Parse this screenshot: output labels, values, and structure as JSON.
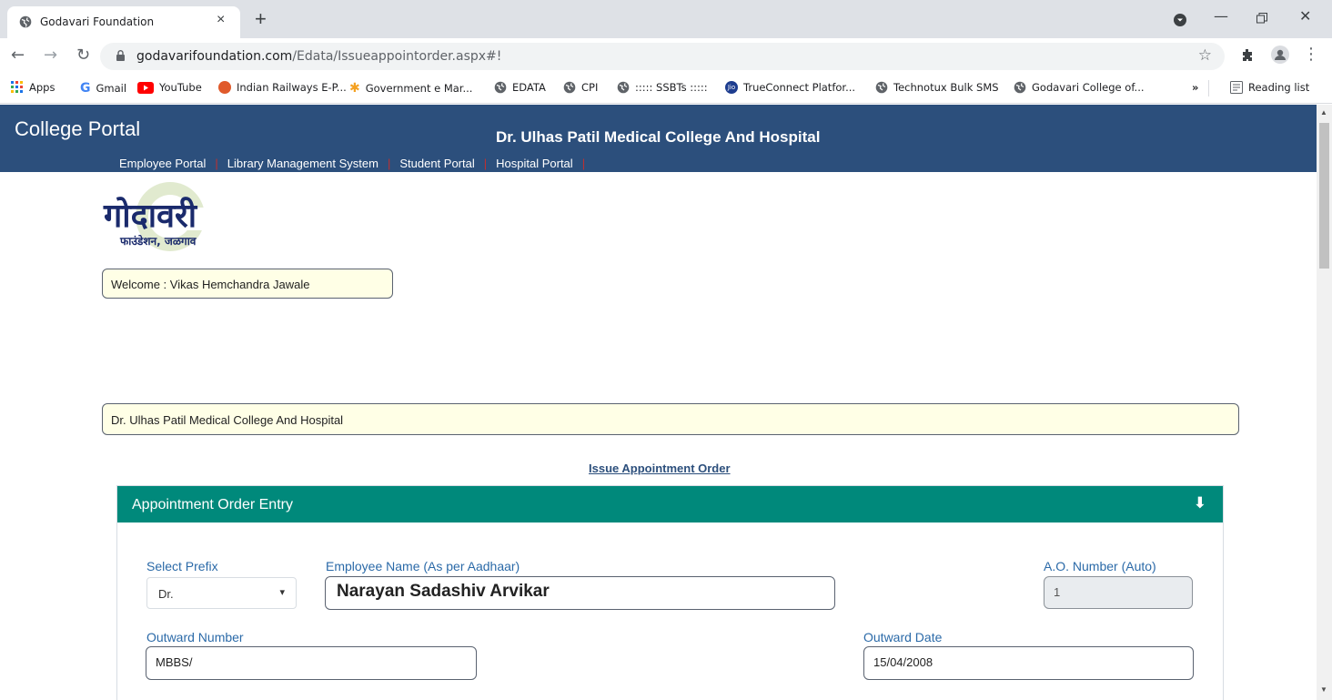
{
  "browser": {
    "tab_title": "Godavari Foundation",
    "tab_close": "×",
    "new_tab": "+",
    "url_host": "godavarifoundation.com",
    "url_path": "/Edata/Issueappointorder.aspx#!",
    "bookmarks": [
      {
        "label": "Apps",
        "icon": "apps-grid-icon",
        "color": "#ea4335"
      },
      {
        "label": "Gmail",
        "icon": "google-g-icon",
        "color": "#4285f4"
      },
      {
        "label": "YouTube",
        "icon": "youtube-icon",
        "color": "#ff0000"
      },
      {
        "label": "Indian Railways E-P...",
        "icon": "railways-icon",
        "color": "#e05a2b"
      },
      {
        "label": "Government e Mar...",
        "icon": "gem-icon",
        "color": "#f4a020"
      },
      {
        "label": "EDATA",
        "icon": "globe-icon",
        "color": "#5f6368"
      },
      {
        "label": "CPI",
        "icon": "globe-icon",
        "color": "#5f6368"
      },
      {
        "label": "::::: SSBTs :::::",
        "icon": "globe-icon",
        "color": "#5f6368"
      },
      {
        "label": "TrueConnect Platfor...",
        "icon": "jio-icon",
        "color": "#1d3d8f"
      },
      {
        "label": "Technotux Bulk SMS",
        "icon": "globe-icon",
        "color": "#5f6368"
      },
      {
        "label": "Godavari College of...",
        "icon": "globe-icon",
        "color": "#5f6368"
      }
    ],
    "more_bookmarks": "»",
    "reading_list": "Reading list"
  },
  "header": {
    "portal_title": "College Portal",
    "college_name": "Dr. Ulhas Patil Medical College And Hospital",
    "nav": [
      "Employee Portal",
      "Library Management System",
      "Student Portal",
      "Hospital Portal"
    ],
    "nav_separator": "|"
  },
  "logo": {
    "text_main": "गोदावरी",
    "text_sub": "फाउंडेशन, जळगाव"
  },
  "welcome": "Welcome : Vikas Hemchandra Jawale",
  "college_box": "Dr. Ulhas Patil Medical College And Hospital",
  "issue_link": "Issue Appointment Order",
  "panel": {
    "title": "Appointment Order Entry",
    "toggle_glyph": "🡇"
  },
  "form": {
    "prefix_label": "Select Prefix",
    "prefix_value": "Dr.",
    "employee_label": "Employee Name (As per Aadhaar)",
    "employee_value": "Narayan Sadashiv Arvikar",
    "ao_label": "A.O. Number (Auto)",
    "ao_value": "1",
    "outward_number_label": "Outward Number",
    "outward_number_value": "MBBS/",
    "outward_date_label": "Outward Date",
    "outward_date_value": "15/04/2008"
  },
  "colors": {
    "header_bg": "#2c4f7c",
    "panel_head_bg": "#00897b",
    "info_box_bg": "#ffffe6",
    "label_blue": "#2b6aa8"
  }
}
